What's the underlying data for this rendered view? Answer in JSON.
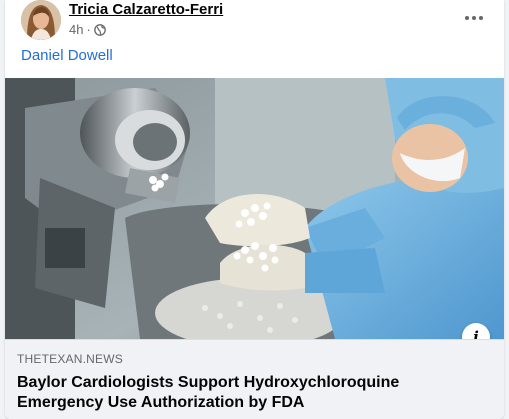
{
  "post": {
    "author": "Tricia Calzaretto-Ferri",
    "time": "4h",
    "separator": "·",
    "privacy_icon": "globe-icon",
    "more_icon": "more-options-icon",
    "mention": "Daniel Dowell"
  },
  "link_preview": {
    "domain": "THETEXAN.NEWS",
    "title": "Baylor Cardiologists Support Hydroxychloroquine Emergency Use Authorization by FDA",
    "info_icon": "info-icon",
    "info_glyph": "i"
  },
  "colors": {
    "link_blue": "#216fdb",
    "muted_text": "#65676b",
    "preview_bg": "#f0f2f5"
  }
}
